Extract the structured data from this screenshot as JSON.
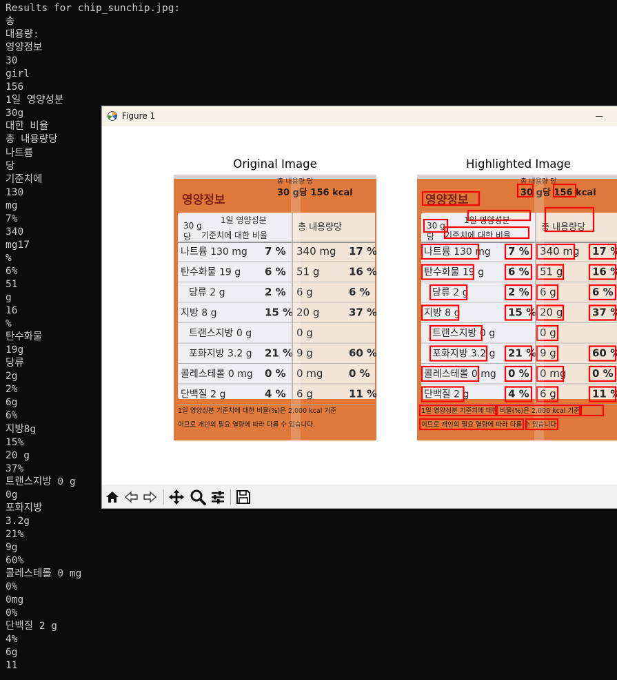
{
  "terminal": {
    "lines": [
      "Results for chip_sunchip.jpg:",
      "송",
      "대용량:",
      "영양정보",
      "30",
      "girl",
      "156",
      "1일 영양성분",
      "30g",
      "대한 비율",
      "총 내용량당",
      "나트륨",
      "당",
      "기준치에",
      "130",
      "mg",
      "7%",
      "340",
      "mg17",
      "%",
      "6%",
      "51",
      "g",
      "16",
      "%",
      "탄수화물",
      "19g",
      "당류",
      "2g",
      "2%",
      "6g",
      "6%",
      "지방8g",
      "15%",
      "20 g",
      "37%",
      "트랜스지방 0 g",
      "0g",
      "포화지방",
      "3.2g",
      "21%",
      "9g",
      "60%",
      "콜레스테롤 0 mg",
      "0%",
      "0mg",
      "0%",
      "단백질 2 g",
      "4%",
      "6g",
      "11"
    ]
  },
  "figure": {
    "window_title": "Figure 1",
    "left_title": "Original Image",
    "right_title": "Highlighted Image"
  },
  "label": {
    "top_strip": "총 내용량 당",
    "header_title": "영양정보",
    "header_right": "30 g당 156 kcal",
    "col1_head_a": "30 g",
    "col1_head_b": "1일 영양성분",
    "col1_head_c": "당",
    "col1_head_d": "기준치에 대한 비율",
    "col2_head": "총 내용량당",
    "rows": [
      {
        "name": "나트륨 130 mg",
        "pct": "7 %",
        "total": "340 mg",
        "tpct": "17 %"
      },
      {
        "name": "탄수화물 19 g",
        "pct": "6 %",
        "total": "51 g",
        "tpct": "16 %"
      },
      {
        "name": "당류 2 g",
        "pct": "2 %",
        "total": "6 g",
        "tpct": "6 %"
      },
      {
        "name": "지방 8 g",
        "pct": "15 %",
        "total": "20 g",
        "tpct": "37 %"
      },
      {
        "name": "트랜스지방 0 g",
        "pct": "",
        "total": "0 g",
        "tpct": ""
      },
      {
        "name": "포화지방 3.2 g",
        "pct": "21 %",
        "total": "9 g",
        "tpct": "60 %"
      },
      {
        "name": "콜레스테롤 0 mg",
        "pct": "0 %",
        "total": "0 mg",
        "tpct": "0 %"
      },
      {
        "name": "단백질 2 g",
        "pct": "4 %",
        "total": "6 g",
        "tpct": "11 %"
      }
    ],
    "footnote1": "1일 영양성분 기준치에 대한 비율(%)은 2,000 kcal 기준",
    "footnote2": "이므로 개인의 필요 열량에 따라 다를 수 있습니다."
  },
  "toolbar": {
    "buttons": [
      "home-icon",
      "back-icon",
      "forward-icon",
      "pan-icon",
      "zoom-icon",
      "configure-subplots-icon",
      "save-icon"
    ]
  },
  "colors": {
    "orange": "#e07a3c",
    "panel": "#efeef2",
    "ink": "#2a2a2a",
    "highlight": "#ff0000"
  }
}
